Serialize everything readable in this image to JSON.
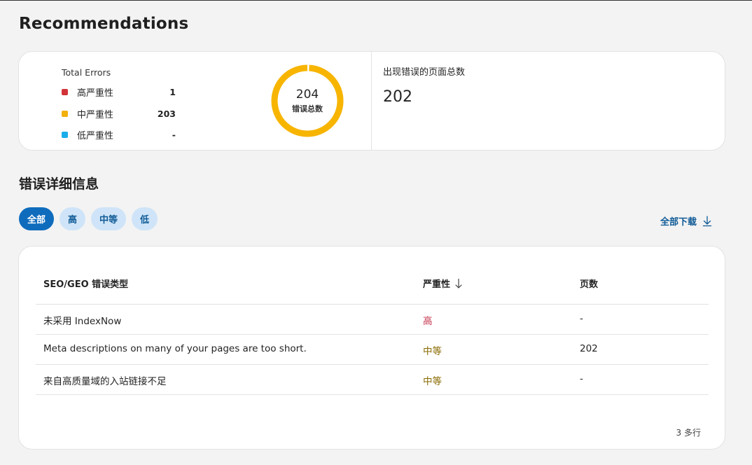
{
  "page": {
    "title": "Recommendations"
  },
  "summary": {
    "legend_title": "Total Errors",
    "items": [
      {
        "label": "高严重性",
        "value": "1",
        "color": "#d13438"
      },
      {
        "label": "中严重性",
        "value": "203",
        "color": "#f2b10b"
      },
      {
        "label": "低严重性",
        "value": "-",
        "color": "#1aaee8"
      }
    ],
    "total_value": "204",
    "total_label": "错误总数",
    "pages_label": "出现错误的页面总数",
    "pages_value": "202"
  },
  "details": {
    "title": "错误详细信息",
    "filters": [
      {
        "label": "全部",
        "active": true
      },
      {
        "label": "高",
        "active": false
      },
      {
        "label": "中等",
        "active": false
      },
      {
        "label": "低",
        "active": false
      }
    ],
    "download_label": "全部下载",
    "table": {
      "headers": {
        "type": "SEO/GEO 错误类型",
        "severity": "严重性",
        "pages": "页数"
      },
      "rows": [
        {
          "type": "未采用 IndexNow",
          "severity": "高",
          "severity_level": "high",
          "pages": "-"
        },
        {
          "type": "Meta descriptions on many of your pages are too short.",
          "severity": "中等",
          "severity_level": "medium",
          "pages": "202"
        },
        {
          "type": "来自高质量域的入站链接不足",
          "severity": "中等",
          "severity_level": "medium",
          "pages": "-"
        }
      ],
      "row_count": "3 多行"
    }
  },
  "icons": {
    "sort": "arrow-down-icon",
    "download": "download-icon"
  },
  "colors": {
    "accent": "#0f6cbd",
    "chip_bg": "#cfe4f8",
    "high": "#c4314b",
    "medium": "#8a6a00"
  }
}
